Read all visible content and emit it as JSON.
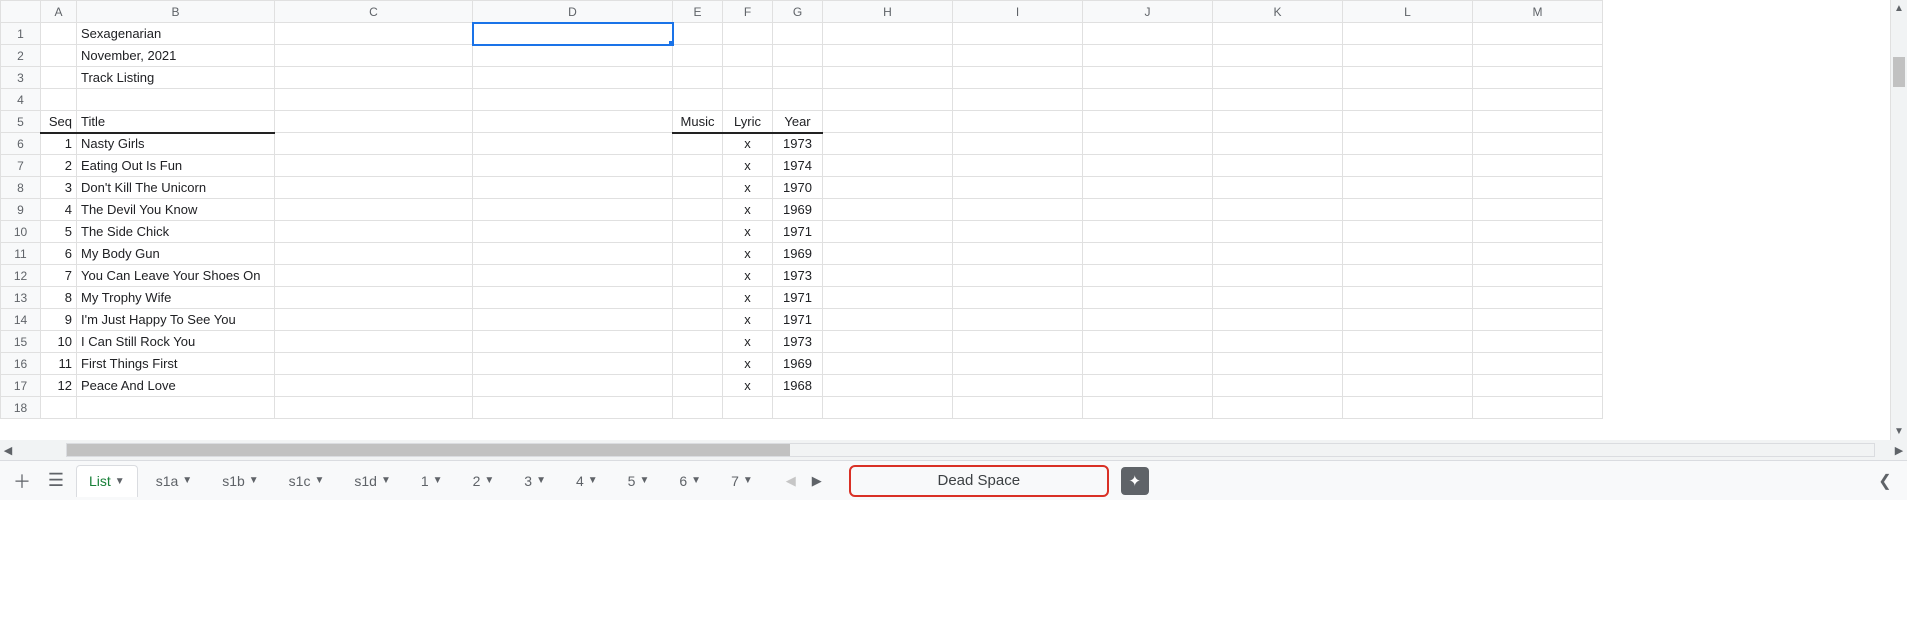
{
  "columns": [
    "A",
    "B",
    "C",
    "D",
    "E",
    "F",
    "G",
    "H",
    "I",
    "J",
    "K",
    "L",
    "M"
  ],
  "row_headers": [
    1,
    2,
    3,
    4,
    5,
    6,
    7,
    8,
    9,
    10,
    11,
    12,
    13,
    14,
    15,
    16,
    17,
    18
  ],
  "header_cells": {
    "b1": "Sexagenarian",
    "b2": "November, 2021",
    "b3": "Track Listing"
  },
  "table_headers": {
    "seq": "Seq",
    "title": "Title",
    "music": "Music",
    "lyric": "Lyric",
    "year": "Year"
  },
  "tracks": [
    {
      "seq": 1,
      "title": "Nasty Girls",
      "music": "",
      "lyric": "x",
      "year": 1973
    },
    {
      "seq": 2,
      "title": "Eating Out Is Fun",
      "music": "",
      "lyric": "x",
      "year": 1974
    },
    {
      "seq": 3,
      "title": "Don't Kill The Unicorn",
      "music": "",
      "lyric": "x",
      "year": 1970
    },
    {
      "seq": 4,
      "title": "The Devil You Know",
      "music": "",
      "lyric": "x",
      "year": 1969
    },
    {
      "seq": 5,
      "title": "The Side Chick",
      "music": "",
      "lyric": "x",
      "year": 1971
    },
    {
      "seq": 6,
      "title": "My Body Gun",
      "music": "",
      "lyric": "x",
      "year": 1969
    },
    {
      "seq": 7,
      "title": "You Can Leave Your Shoes On",
      "music": "",
      "lyric": "x",
      "year": 1973
    },
    {
      "seq": 8,
      "title": "My Trophy Wife",
      "music": "",
      "lyric": "x",
      "year": 1971
    },
    {
      "seq": 9,
      "title": "I'm Just Happy To See You",
      "music": "",
      "lyric": "x",
      "year": 1971
    },
    {
      "seq": 10,
      "title": "I Can Still Rock You",
      "music": "",
      "lyric": "x",
      "year": 1973
    },
    {
      "seq": 11,
      "title": "First Things First",
      "music": "",
      "lyric": "x",
      "year": 1969
    },
    {
      "seq": 12,
      "title": "Peace And Love",
      "music": "",
      "lyric": "x",
      "year": 1968
    }
  ],
  "active_cell": "D1",
  "tabs": {
    "active": "List",
    "others": [
      "s1a",
      "s1b",
      "s1c",
      "s1d",
      "1",
      "2",
      "3",
      "4",
      "5",
      "6",
      "7"
    ]
  },
  "deadspace_label": "Dead Space"
}
